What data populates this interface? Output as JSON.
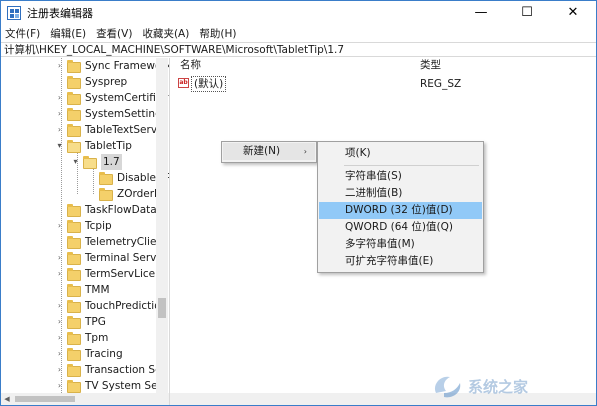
{
  "window": {
    "title": "注册表编辑器",
    "min_glyph": "—",
    "max_glyph": "☐",
    "close_glyph": "✕"
  },
  "menubar": {
    "items": [
      "文件(F)",
      "编辑(E)",
      "查看(V)",
      "收藏夹(A)",
      "帮助(H)"
    ]
  },
  "address": {
    "path": "计算机\\HKEY_LOCAL_MACHINE\\SOFTWARE\\Microsoft\\TabletTip\\1.7"
  },
  "tree": {
    "items": [
      {
        "label": "Sync Framework",
        "expandable": true
      },
      {
        "label": "Sysprep",
        "expandable": false
      },
      {
        "label": "SystemCertificat",
        "expandable": true
      },
      {
        "label": "SystemSettings",
        "expandable": true
      },
      {
        "label": "TableTextServic",
        "expandable": true
      },
      {
        "label": "TabletTip",
        "expandable": true,
        "expanded": true
      },
      {
        "label": "1.7",
        "expandable": true,
        "expanded": true,
        "selected": true
      },
      {
        "label": "DisableInPla",
        "expandable": false
      },
      {
        "label": "ZOrderNonC",
        "expandable": false
      },
      {
        "label": "TaskFlowDataEr",
        "expandable": false
      },
      {
        "label": "Tcpip",
        "expandable": true
      },
      {
        "label": "TelemetryClient",
        "expandable": false
      },
      {
        "label": "Terminal Server",
        "expandable": true
      },
      {
        "label": "TermServLicens",
        "expandable": true
      },
      {
        "label": "TMM",
        "expandable": false
      },
      {
        "label": "TouchPrediction",
        "expandable": true
      },
      {
        "label": "TPG",
        "expandable": true
      },
      {
        "label": "Tpm",
        "expandable": true
      },
      {
        "label": "Tracing",
        "expandable": true
      },
      {
        "label": "Transaction Ser",
        "expandable": true
      },
      {
        "label": "TV System Serv",
        "expandable": true
      }
    ]
  },
  "values": {
    "columns": {
      "name": "名称",
      "type": "类型"
    },
    "rows": [
      {
        "name": "(默认)",
        "type": "REG_SZ",
        "icon": "ab"
      }
    ]
  },
  "context_menu": {
    "new_label": "新建(N)",
    "arrow": "›"
  },
  "submenu": {
    "items": [
      {
        "label": "项(K)"
      },
      {
        "label": "字符串值(S)"
      },
      {
        "label": "二进制值(B)"
      },
      {
        "label": "DWORD (32 位)值(D)",
        "highlighted": true
      },
      {
        "label": "QWORD (64 位)值(Q)"
      },
      {
        "label": "多字符串值(M)"
      },
      {
        "label": "可扩充字符串值(E)"
      }
    ]
  },
  "colors": {
    "highlight": "#91c9f7",
    "folder": "#f4d06a",
    "window_border": "#3a7dc9"
  },
  "watermark": {
    "text": "系统之家"
  }
}
